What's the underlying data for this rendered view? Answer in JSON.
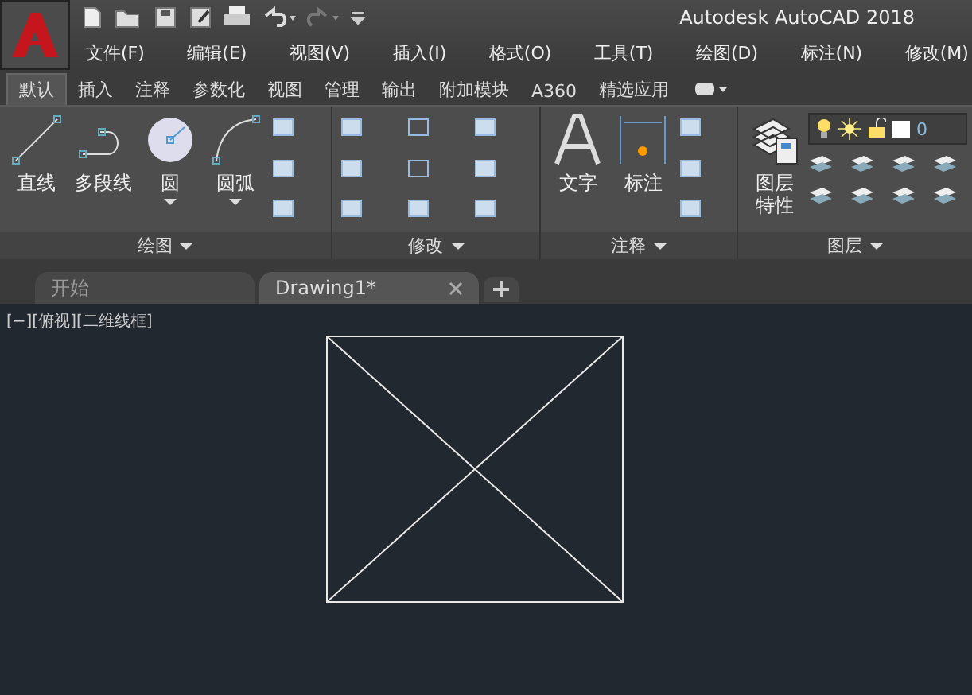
{
  "window": {
    "title": "Autodesk AutoCAD 2018"
  },
  "menu": [
    "文件(F)",
    "编辑(E)",
    "视图(V)",
    "插入(I)",
    "格式(O)",
    "工具(T)",
    "绘图(D)",
    "标注(N)",
    "修改(M)"
  ],
  "ribbon_tabs": [
    {
      "label": "默认",
      "selected": true
    },
    {
      "label": "插入",
      "selected": false
    },
    {
      "label": "注释",
      "selected": false
    },
    {
      "label": "参数化",
      "selected": false
    },
    {
      "label": "视图",
      "selected": false
    },
    {
      "label": "管理",
      "selected": false
    },
    {
      "label": "输出",
      "selected": false
    },
    {
      "label": "附加模块",
      "selected": false
    },
    {
      "label": "A360",
      "selected": false
    },
    {
      "label": "精选应用",
      "selected": false
    }
  ],
  "panels": [
    {
      "title": "绘图",
      "tools": [
        {
          "label": "直线",
          "dropdown": false
        },
        {
          "label": "多段线",
          "dropdown": false
        },
        {
          "label": "圆",
          "dropdown": true
        },
        {
          "label": "圆弧",
          "dropdown": true
        }
      ]
    },
    {
      "title": "修改"
    },
    {
      "title": "注释",
      "tools": [
        {
          "label": "文字",
          "dropdown": false
        },
        {
          "label": "标注",
          "dropdown": false
        }
      ]
    },
    {
      "title": "图层",
      "tools": [
        {
          "label": "图层特性",
          "dropdown": false
        }
      ]
    }
  ],
  "layer_value": "0",
  "doc_tabs": [
    {
      "label": "开始",
      "selected": false
    },
    {
      "label": "Drawing1*",
      "selected": true
    }
  ],
  "viewport_label": "[−][俯视][二维线框]"
}
